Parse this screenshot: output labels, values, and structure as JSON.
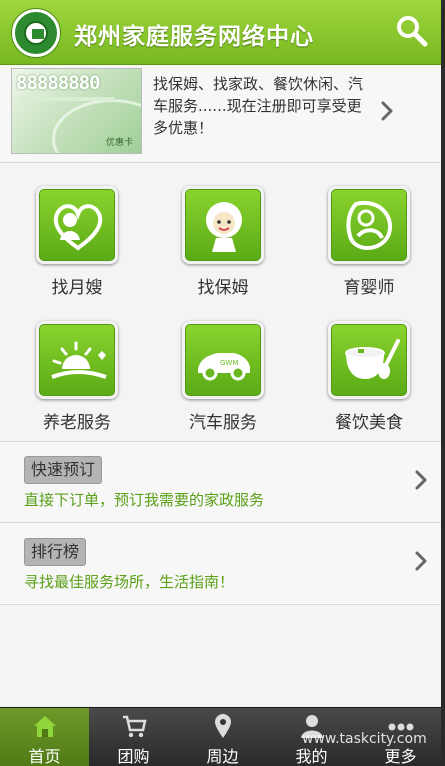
{
  "header": {
    "title": "郑州家庭服务网络中心",
    "logo_icon": "family-service-logo",
    "search_icon": "search-icon",
    "accent": "#8ccc2f"
  },
  "promo": {
    "card_number": "88888880",
    "card_label": "优惠卡",
    "text": "找保姆、找家政、餐饮休闲、汽车服务......现在注册即可享受更多优惠！"
  },
  "services": [
    {
      "label": "找月嫂",
      "icon": "mother-baby-heart-icon"
    },
    {
      "label": "找保姆",
      "icon": "nanny-icon"
    },
    {
      "label": "育婴师",
      "icon": "nursing-mother-icon"
    },
    {
      "label": "养老服务",
      "icon": "sunrise-icon"
    },
    {
      "label": "汽车服务",
      "icon": "car-icon"
    },
    {
      "label": "餐饮美食",
      "icon": "bowl-spoon-icon"
    }
  ],
  "quick_order": {
    "badge": "快速预订",
    "subtitle": "直接下订单，预订我需要的家政服务"
  },
  "ranking": {
    "badge": "排行榜",
    "subtitle": "寻找最佳服务场所，生活指南！"
  },
  "tabbar": {
    "active": "首页",
    "items": [
      {
        "label": "首页",
        "icon": "home-icon"
      },
      {
        "label": "团购",
        "icon": "shopping-cart-icon"
      },
      {
        "label": "周边",
        "icon": "location-pin-icon"
      },
      {
        "label": "我的",
        "icon": "user-icon"
      },
      {
        "label": "更多",
        "icon": "more-dots-icon"
      }
    ]
  },
  "watermark": "www.taskcity.com"
}
